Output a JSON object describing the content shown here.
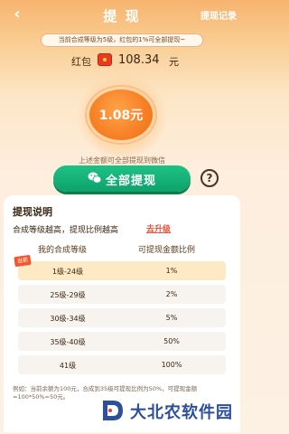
{
  "header": {
    "back": "‹",
    "title": "提 现",
    "record": "提现记录"
  },
  "tip": "当前合成等级为5级，红包的1%可全部提现~",
  "redpacket": {
    "label": "红包",
    "amount": "108.34",
    "unit": "元"
  },
  "coin_value": "1.08元",
  "wechat_note": "上述金额可全部提现到微信",
  "withdraw_button": "全部提现",
  "help": "?",
  "explain": {
    "title": "提现说明",
    "sub": "合成等级越高，提现比例越高",
    "upgrade": "去升级",
    "col_level": "我的合成等级",
    "col_ratio": "可提现金额比例",
    "current_tag": "当前",
    "rows": [
      {
        "level": "1级-24级",
        "ratio": "1%"
      },
      {
        "level": "25级-29级",
        "ratio": "2%"
      },
      {
        "level": "30级-34级",
        "ratio": "5%"
      },
      {
        "level": "35级-40级",
        "ratio": "50%"
      },
      {
        "level": "41级",
        "ratio": "100%"
      }
    ],
    "example": "例如：当前余额为100元，合成到35级可提现比例为50%，可提现金额=100*50%=50元。"
  },
  "watermark": "大北农软件园"
}
